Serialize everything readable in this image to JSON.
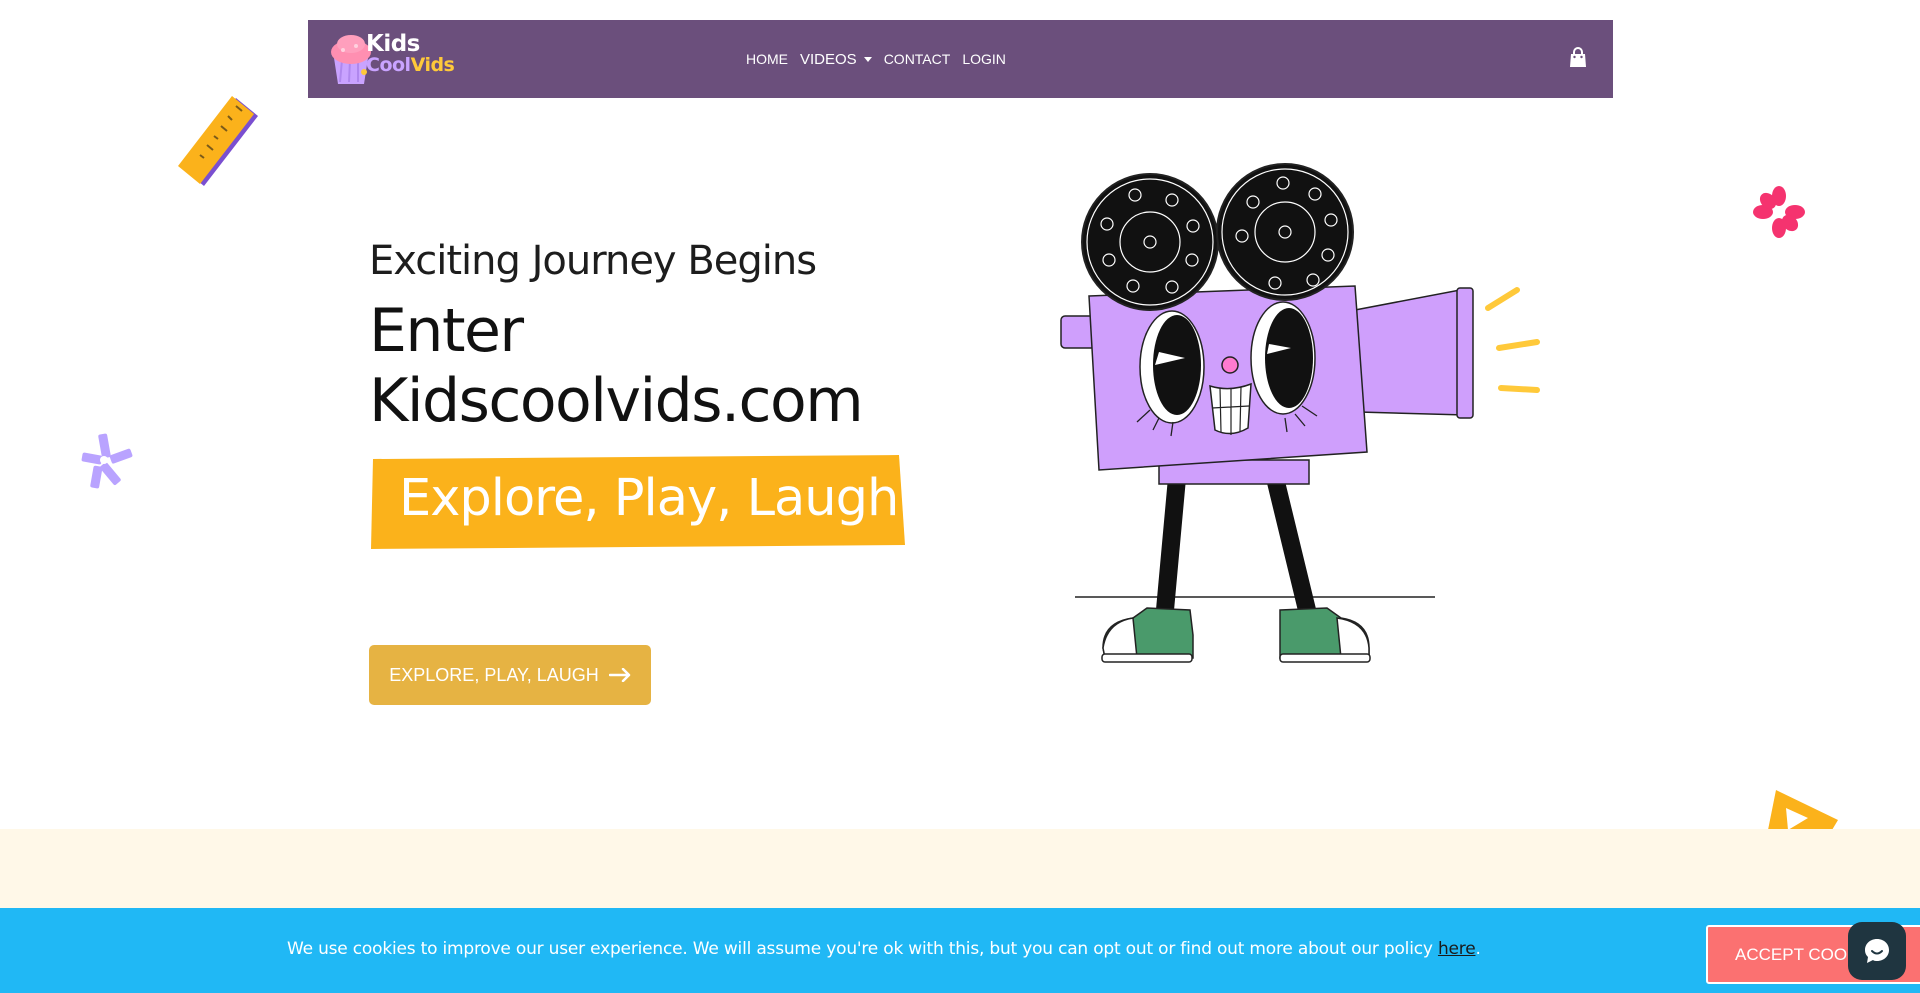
{
  "navbar": {
    "logo": {
      "line1": "Kids",
      "cool": "Cool",
      "vids": "Vids"
    },
    "links": [
      {
        "label": "HOME"
      },
      {
        "label": "VIDEOS"
      },
      {
        "label": "CONTACT"
      },
      {
        "label": "LOGIN"
      }
    ],
    "cart_icon": "shopping-bag-icon"
  },
  "hero": {
    "subtitle": "Exciting Journey Begins",
    "title_line1": "Enter",
    "title_line2": "Kidscoolvids.com",
    "banner": "Explore, Play, Laugh",
    "cta_label": "EXPLORE, PLAY, LAUGH",
    "cta_icon": "arrow-right-icon"
  },
  "cookie": {
    "text": "We use cookies to improve our user experience. We will assume you're ok with this, but you can opt out or find out more about our policy ",
    "link": "here",
    "suffix": ".",
    "accept_label": "ACCEPT COOKIES"
  },
  "chat": {
    "icon": "chat-bubble-icon"
  },
  "colors": {
    "navbar": "#6b4f7c",
    "banner": "#fbb21b",
    "cta": "#e6b343",
    "cookie_bar": "#20b8f5",
    "accept": "#fb7171",
    "camera_body": "#cf9ffc"
  }
}
